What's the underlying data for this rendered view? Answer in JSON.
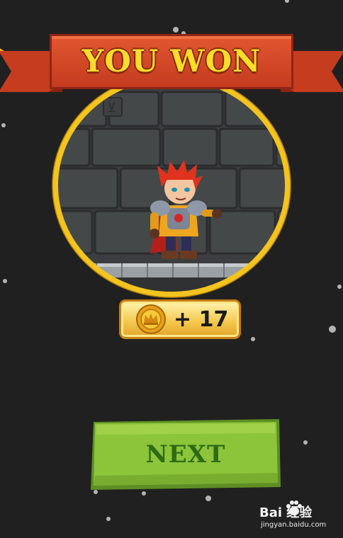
{
  "banner": {
    "title": "YOU WON"
  },
  "reward": {
    "prefix": "+ ",
    "amount": "17",
    "icon": "crown-coin-icon"
  },
  "next_button": {
    "label": "NEXT"
  },
  "watermark": {
    "brand": "Bai  经验",
    "url": "jingyan.baidu.com"
  },
  "colors": {
    "background": "#202020",
    "ribbon": "#d8492a",
    "title_text": "#f8dd2a",
    "frame_gold": "#f3c41f",
    "button_green": "#8cc43a",
    "button_text": "#2d6b14"
  }
}
